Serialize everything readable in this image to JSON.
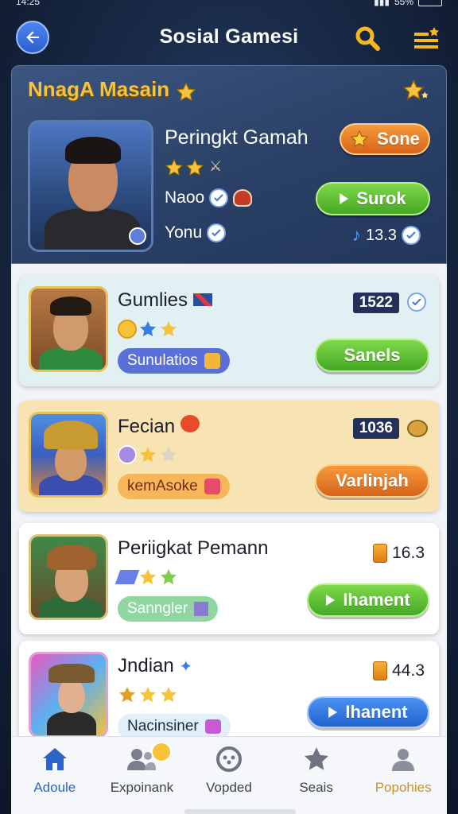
{
  "status_bar": {
    "time": "14:25",
    "battery": "55%"
  },
  "header": {
    "title": "Sosial Gamesi"
  },
  "hero": {
    "title": "NnagA Masain",
    "rank_label": "Peringkt Gamah",
    "line1": "Naoo",
    "line2": "Yonu",
    "badge_button": "Sone",
    "primary_button": "Surok",
    "score": "13.3"
  },
  "players": [
    {
      "name": "Gumlies",
      "tag": "Sunulatios",
      "score": "1522",
      "button": "Sanels"
    },
    {
      "name": "Fecian",
      "tag": "kemAsoke",
      "score": "1036",
      "button": "Varlinjah"
    },
    {
      "name": "Periigkat Pemann",
      "tag": "Sanngler",
      "score": "16.3",
      "button": "Ihament"
    },
    {
      "name": "Jndian",
      "tag": "Nacinsiner",
      "score": "44.3",
      "button": "Ihanent"
    }
  ],
  "nav": {
    "items": [
      {
        "label": "Adoule"
      },
      {
        "label": "Expoinank"
      },
      {
        "label": "Vopded"
      },
      {
        "label": "Seais"
      },
      {
        "label": "Popohies"
      }
    ]
  },
  "colors": {
    "accent_gold": "#f6c33a",
    "primary_blue": "#2d63c8",
    "green": "#45a824",
    "orange": "#d7641a"
  }
}
